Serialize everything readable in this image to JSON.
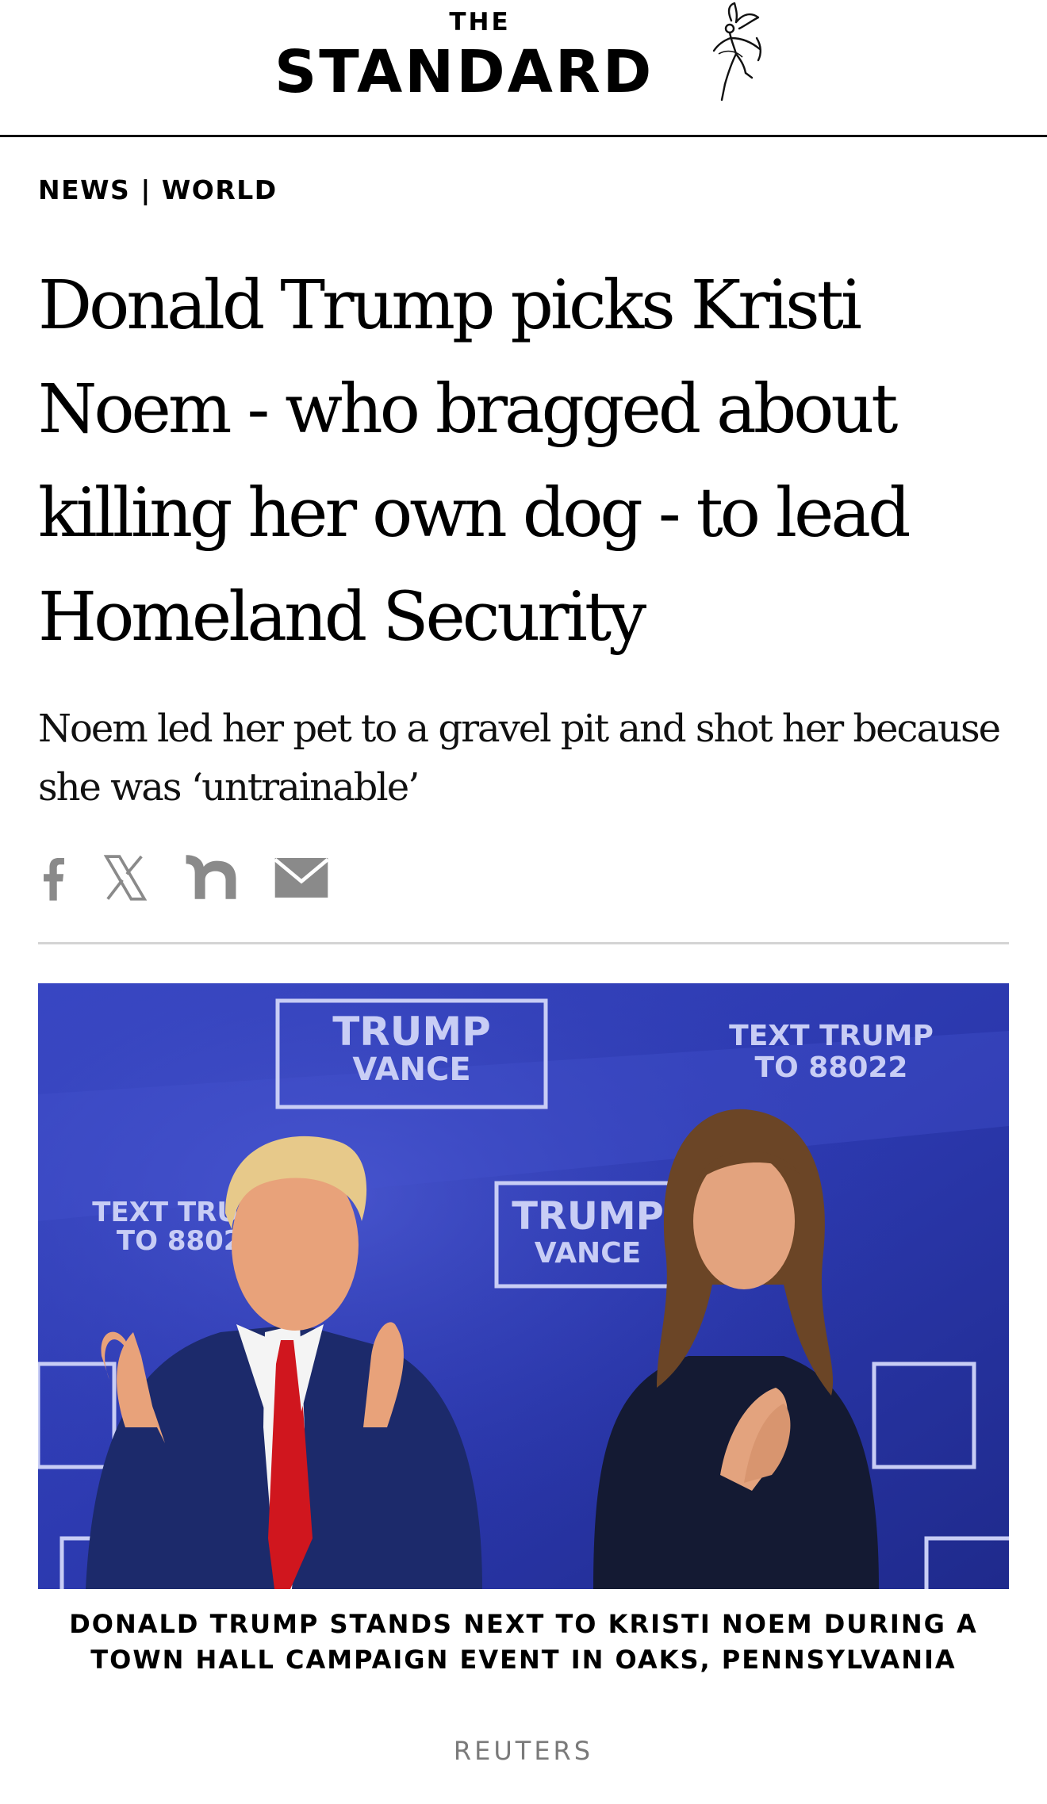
{
  "masthead": {
    "brand_small": "THE",
    "brand_large": "STANDARD"
  },
  "breadcrumb": {
    "section": "NEWS",
    "separator": "|",
    "subsection": "WORLD"
  },
  "article": {
    "headline": "Donald Trump picks Kristi Noem - who bragged about killing her own dog - to lead Homeland Security",
    "standfirst": "Noem led her pet to a gravel pit and shot her because she was ‘untrainable’"
  },
  "share": {
    "buttons": [
      "facebook-icon",
      "x-icon",
      "nextdoor-icon",
      "email-icon"
    ],
    "icon_color": "#8a8a8a"
  },
  "hero": {
    "signs": {
      "trump": "TRUMP",
      "vance": "VANCE",
      "text_line1": "TEXT TRUMP",
      "text_line2": "TO 88022"
    },
    "caption": "DONALD TRUMP STANDS NEXT TO KRISTI NOEM DURING A TOWN HALL CAMPAIGN EVENT IN OAKS, PENNSYLVANIA",
    "credit": "REUTERS"
  },
  "colors": {
    "text": "#000000",
    "backdrop_blue": "#2f3fb8",
    "tie_red": "#d0161e",
    "suit_navy": "#1c2a6b",
    "credit_grey": "#7a7a7a"
  }
}
